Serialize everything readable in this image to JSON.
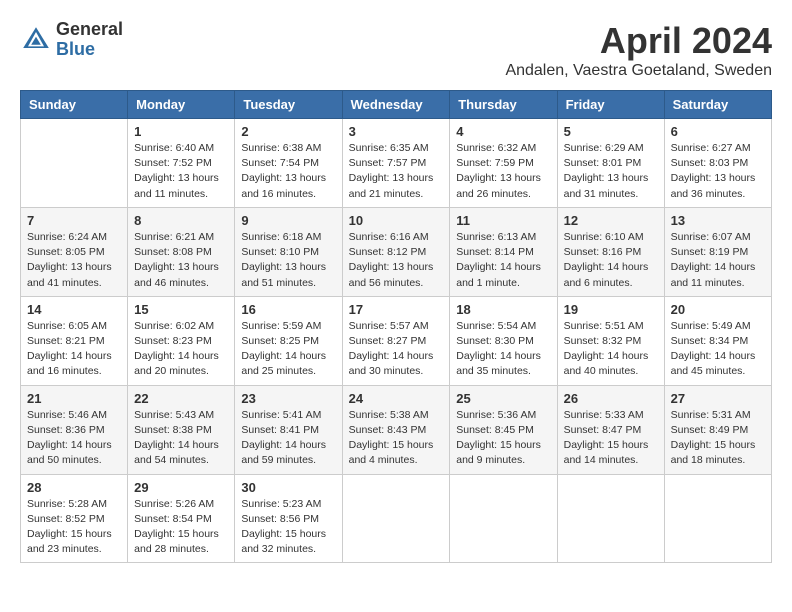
{
  "header": {
    "logo_line1": "General",
    "logo_line2": "Blue",
    "month_title": "April 2024",
    "location": "Andalen, Vaestra Goetaland, Sweden"
  },
  "columns": [
    "Sunday",
    "Monday",
    "Tuesday",
    "Wednesday",
    "Thursday",
    "Friday",
    "Saturday"
  ],
  "weeks": [
    [
      {
        "day": "",
        "info": ""
      },
      {
        "day": "1",
        "info": "Sunrise: 6:40 AM\nSunset: 7:52 PM\nDaylight: 13 hours\nand 11 minutes."
      },
      {
        "day": "2",
        "info": "Sunrise: 6:38 AM\nSunset: 7:54 PM\nDaylight: 13 hours\nand 16 minutes."
      },
      {
        "day": "3",
        "info": "Sunrise: 6:35 AM\nSunset: 7:57 PM\nDaylight: 13 hours\nand 21 minutes."
      },
      {
        "day": "4",
        "info": "Sunrise: 6:32 AM\nSunset: 7:59 PM\nDaylight: 13 hours\nand 26 minutes."
      },
      {
        "day": "5",
        "info": "Sunrise: 6:29 AM\nSunset: 8:01 PM\nDaylight: 13 hours\nand 31 minutes."
      },
      {
        "day": "6",
        "info": "Sunrise: 6:27 AM\nSunset: 8:03 PM\nDaylight: 13 hours\nand 36 minutes."
      }
    ],
    [
      {
        "day": "7",
        "info": "Sunrise: 6:24 AM\nSunset: 8:05 PM\nDaylight: 13 hours\nand 41 minutes."
      },
      {
        "day": "8",
        "info": "Sunrise: 6:21 AM\nSunset: 8:08 PM\nDaylight: 13 hours\nand 46 minutes."
      },
      {
        "day": "9",
        "info": "Sunrise: 6:18 AM\nSunset: 8:10 PM\nDaylight: 13 hours\nand 51 minutes."
      },
      {
        "day": "10",
        "info": "Sunrise: 6:16 AM\nSunset: 8:12 PM\nDaylight: 13 hours\nand 56 minutes."
      },
      {
        "day": "11",
        "info": "Sunrise: 6:13 AM\nSunset: 8:14 PM\nDaylight: 14 hours\nand 1 minute."
      },
      {
        "day": "12",
        "info": "Sunrise: 6:10 AM\nSunset: 8:16 PM\nDaylight: 14 hours\nand 6 minutes."
      },
      {
        "day": "13",
        "info": "Sunrise: 6:07 AM\nSunset: 8:19 PM\nDaylight: 14 hours\nand 11 minutes."
      }
    ],
    [
      {
        "day": "14",
        "info": "Sunrise: 6:05 AM\nSunset: 8:21 PM\nDaylight: 14 hours\nand 16 minutes."
      },
      {
        "day": "15",
        "info": "Sunrise: 6:02 AM\nSunset: 8:23 PM\nDaylight: 14 hours\nand 20 minutes."
      },
      {
        "day": "16",
        "info": "Sunrise: 5:59 AM\nSunset: 8:25 PM\nDaylight: 14 hours\nand 25 minutes."
      },
      {
        "day": "17",
        "info": "Sunrise: 5:57 AM\nSunset: 8:27 PM\nDaylight: 14 hours\nand 30 minutes."
      },
      {
        "day": "18",
        "info": "Sunrise: 5:54 AM\nSunset: 8:30 PM\nDaylight: 14 hours\nand 35 minutes."
      },
      {
        "day": "19",
        "info": "Sunrise: 5:51 AM\nSunset: 8:32 PM\nDaylight: 14 hours\nand 40 minutes."
      },
      {
        "day": "20",
        "info": "Sunrise: 5:49 AM\nSunset: 8:34 PM\nDaylight: 14 hours\nand 45 minutes."
      }
    ],
    [
      {
        "day": "21",
        "info": "Sunrise: 5:46 AM\nSunset: 8:36 PM\nDaylight: 14 hours\nand 50 minutes."
      },
      {
        "day": "22",
        "info": "Sunrise: 5:43 AM\nSunset: 8:38 PM\nDaylight: 14 hours\nand 54 minutes."
      },
      {
        "day": "23",
        "info": "Sunrise: 5:41 AM\nSunset: 8:41 PM\nDaylight: 14 hours\nand 59 minutes."
      },
      {
        "day": "24",
        "info": "Sunrise: 5:38 AM\nSunset: 8:43 PM\nDaylight: 15 hours\nand 4 minutes."
      },
      {
        "day": "25",
        "info": "Sunrise: 5:36 AM\nSunset: 8:45 PM\nDaylight: 15 hours\nand 9 minutes."
      },
      {
        "day": "26",
        "info": "Sunrise: 5:33 AM\nSunset: 8:47 PM\nDaylight: 15 hours\nand 14 minutes."
      },
      {
        "day": "27",
        "info": "Sunrise: 5:31 AM\nSunset: 8:49 PM\nDaylight: 15 hours\nand 18 minutes."
      }
    ],
    [
      {
        "day": "28",
        "info": "Sunrise: 5:28 AM\nSunset: 8:52 PM\nDaylight: 15 hours\nand 23 minutes."
      },
      {
        "day": "29",
        "info": "Sunrise: 5:26 AM\nSunset: 8:54 PM\nDaylight: 15 hours\nand 28 minutes."
      },
      {
        "day": "30",
        "info": "Sunrise: 5:23 AM\nSunset: 8:56 PM\nDaylight: 15 hours\nand 32 minutes."
      },
      {
        "day": "",
        "info": ""
      },
      {
        "day": "",
        "info": ""
      },
      {
        "day": "",
        "info": ""
      },
      {
        "day": "",
        "info": ""
      }
    ]
  ]
}
